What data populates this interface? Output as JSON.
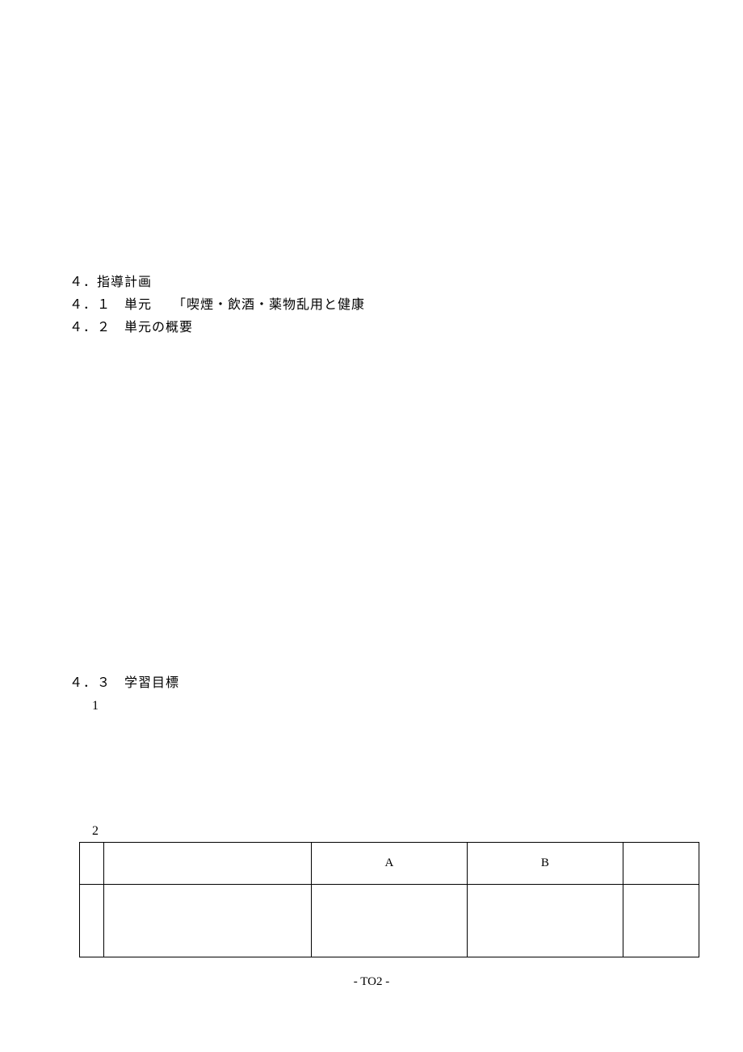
{
  "section4": {
    "heading": "４．指導計画",
    "sub1": "４．１　単元　　「喫煙・飲酒・薬物乱用と健康",
    "sub2": "４．２　単元の概要"
  },
  "section43": {
    "heading": "４．３　学習目標",
    "item1": "1",
    "item2": "2"
  },
  "table": {
    "headerA": "A",
    "headerB": "B"
  },
  "footer": "- TO2 -"
}
